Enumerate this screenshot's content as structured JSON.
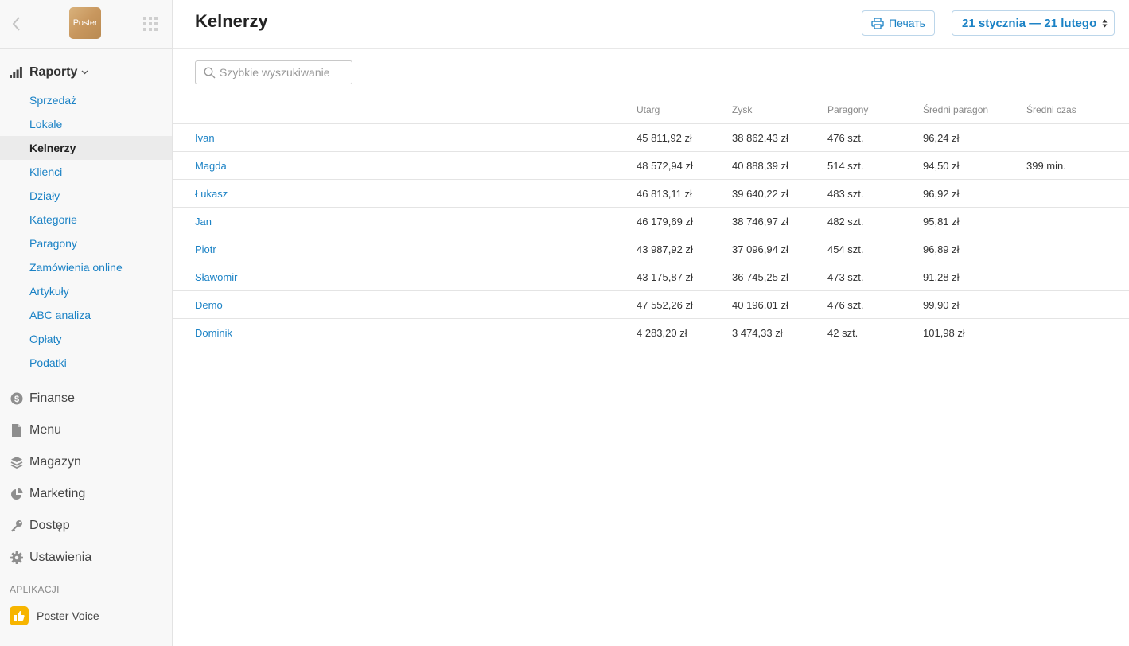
{
  "sidebar": {
    "logo_text": "Poster",
    "reports_label": "Raporty",
    "report_items": [
      {
        "label": "Sprzedaż"
      },
      {
        "label": "Lokale"
      },
      {
        "label": "Kelnerzy",
        "active": true
      },
      {
        "label": "Klienci"
      },
      {
        "label": "Działy"
      },
      {
        "label": "Kategorie"
      },
      {
        "label": "Paragony"
      },
      {
        "label": "Zamówienia online"
      },
      {
        "label": "Artykuły"
      },
      {
        "label": "ABC analiza"
      },
      {
        "label": "Opłaty"
      },
      {
        "label": "Podatki"
      }
    ],
    "sections": [
      {
        "label": "Finanse",
        "icon": "dollar-icon"
      },
      {
        "label": "Menu",
        "icon": "document-icon"
      },
      {
        "label": "Magazyn",
        "icon": "layers-icon"
      },
      {
        "label": "Marketing",
        "icon": "pie-chart-icon"
      },
      {
        "label": "Dostęp",
        "icon": "key-icon"
      },
      {
        "label": "Ustawienia",
        "icon": "gear-icon"
      }
    ],
    "apps_title": "APLIKACJI",
    "apps": [
      {
        "label": "Poster Voice",
        "icon": "thumbs-up-icon"
      }
    ]
  },
  "header": {
    "title": "Kelnerzy",
    "print_label": "Печать",
    "date_range": "21 stycznia — 21 lutego"
  },
  "search": {
    "placeholder": "Szybkie wyszukiwanie",
    "value": ""
  },
  "table": {
    "columns": [
      "",
      "Utarg",
      "Zysk",
      "Paragony",
      "Średni paragon",
      "Średni czas"
    ],
    "rows": [
      {
        "name": "Ivan",
        "utarg": "45 811,92 zł",
        "zysk": "38 862,43 zł",
        "paragony": "476 szt.",
        "sredni_paragon": "96,24 zł",
        "sredni_czas": ""
      },
      {
        "name": "Magda",
        "utarg": "48 572,94 zł",
        "zysk": "40 888,39 zł",
        "paragony": "514 szt.",
        "sredni_paragon": "94,50 zł",
        "sredni_czas": "399 min."
      },
      {
        "name": "Łukasz",
        "utarg": "46 813,11 zł",
        "zysk": "39 640,22 zł",
        "paragony": "483 szt.",
        "sredni_paragon": "96,92 zł",
        "sredni_czas": ""
      },
      {
        "name": "Jan",
        "utarg": "46 179,69 zł",
        "zysk": "38 746,97 zł",
        "paragony": "482 szt.",
        "sredni_paragon": "95,81 zł",
        "sredni_czas": ""
      },
      {
        "name": "Piotr",
        "utarg": "43 987,92 zł",
        "zysk": "37 096,94 zł",
        "paragony": "454 szt.",
        "sredni_paragon": "96,89 zł",
        "sredni_czas": ""
      },
      {
        "name": "Sławomir",
        "utarg": "43 175,87 zł",
        "zysk": "36 745,25 zł",
        "paragony": "473 szt.",
        "sredni_paragon": "91,28 zł",
        "sredni_czas": ""
      },
      {
        "name": "Demo",
        "utarg": "47 552,26 zł",
        "zysk": "40 196,01 zł",
        "paragony": "476 szt.",
        "sredni_paragon": "99,90 zł",
        "sredni_czas": ""
      },
      {
        "name": "Dominik",
        "utarg": "4 283,20 zł",
        "zysk": "3 474,33 zł",
        "paragony": "42 szt.",
        "sredni_paragon": "101,98 zł",
        "sredni_czas": ""
      }
    ]
  },
  "colors": {
    "accent": "#1b82c5",
    "sidebar_bg": "#f8f8f8",
    "active_bg": "#ebebeb",
    "app_icon": "#f7b500"
  }
}
